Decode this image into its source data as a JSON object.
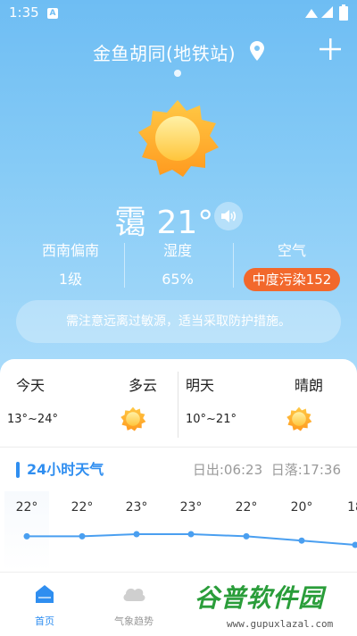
{
  "status_bar": {
    "time": "1:35",
    "notification_badge": "A"
  },
  "header": {
    "location": "金鱼胡同(地铁站)"
  },
  "current": {
    "condition": "霭 21°",
    "stats": [
      {
        "label": "西南偏南",
        "value": "1级"
      },
      {
        "label": "湿度",
        "value": "65%"
      },
      {
        "label": "空气",
        "value": "中度污染152"
      }
    ],
    "notice": "需注意远离过敏源，适当采取防护措施。"
  },
  "forecast": [
    {
      "day": "今天",
      "condition": "多云",
      "range": "13°~24°"
    },
    {
      "day": "明天",
      "condition": "晴朗",
      "range": "10°~21°"
    }
  ],
  "hourly": {
    "title": "24小时天气",
    "sunrise": "日出:06:23",
    "sunset": "日落:17:36",
    "temps": [
      "22°",
      "22°",
      "23°",
      "23°",
      "22°",
      "20°",
      "18"
    ]
  },
  "tabs": [
    {
      "label": "首页",
      "icon": "home-icon"
    },
    {
      "label": "气象趋势",
      "icon": "cloud-icon"
    }
  ],
  "watermark": {
    "brand": "谷普软件园",
    "url": "www.gupuxlazal.com"
  },
  "colors": {
    "accent": "#2f8ef0",
    "aqi_badge": "#f2682c",
    "sky_top": "#6ebdf3"
  }
}
